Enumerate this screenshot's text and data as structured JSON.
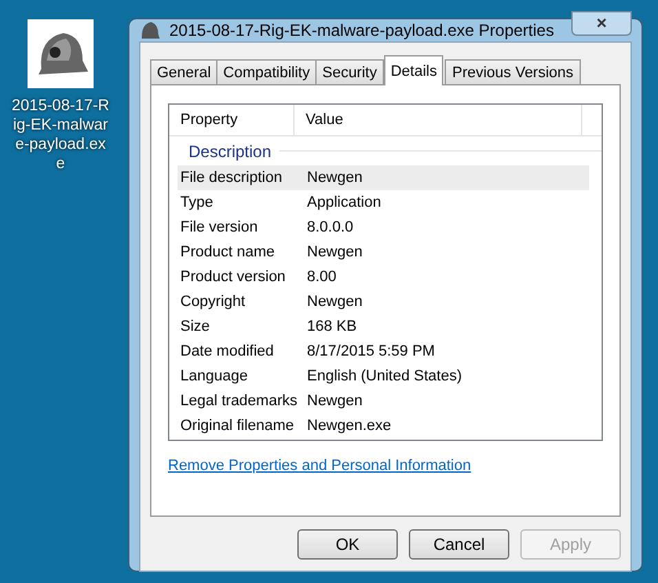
{
  "desktop_icon": {
    "label": "2015-08-17-Rig-EK-malware-payload.exe"
  },
  "window": {
    "title": "2015-08-17-Rig-EK-malware-payload.exe Properties",
    "close": "×"
  },
  "tabs": [
    {
      "label": "General",
      "selected": false
    },
    {
      "label": "Compatibility",
      "selected": false
    },
    {
      "label": "Security",
      "selected": false
    },
    {
      "label": "Details",
      "selected": true
    },
    {
      "label": "Previous Versions",
      "selected": false
    }
  ],
  "table": {
    "columns": [
      "Property",
      "Value"
    ],
    "group": "Description",
    "rows": [
      {
        "property": "File description",
        "value": "Newgen",
        "selected": true
      },
      {
        "property": "Type",
        "value": "Application",
        "selected": false
      },
      {
        "property": "File version",
        "value": "8.0.0.0",
        "selected": false
      },
      {
        "property": "Product name",
        "value": "Newgen",
        "selected": false
      },
      {
        "property": "Product version",
        "value": "8.00",
        "selected": false
      },
      {
        "property": "Copyright",
        "value": "Newgen",
        "selected": false
      },
      {
        "property": "Size",
        "value": "168 KB",
        "selected": false
      },
      {
        "property": "Date modified",
        "value": "8/17/2015 5:59 PM",
        "selected": false
      },
      {
        "property": "Language",
        "value": "English (United States)",
        "selected": false
      },
      {
        "property": "Legal trademarks",
        "value": "Newgen",
        "selected": false
      },
      {
        "property": "Original filename",
        "value": "Newgen.exe",
        "selected": false
      }
    ]
  },
  "link": "Remove Properties and Personal Information",
  "buttons": [
    {
      "label": "OK",
      "disabled": false
    },
    {
      "label": "Cancel",
      "disabled": false
    },
    {
      "label": "Apply",
      "disabled": true
    }
  ]
}
